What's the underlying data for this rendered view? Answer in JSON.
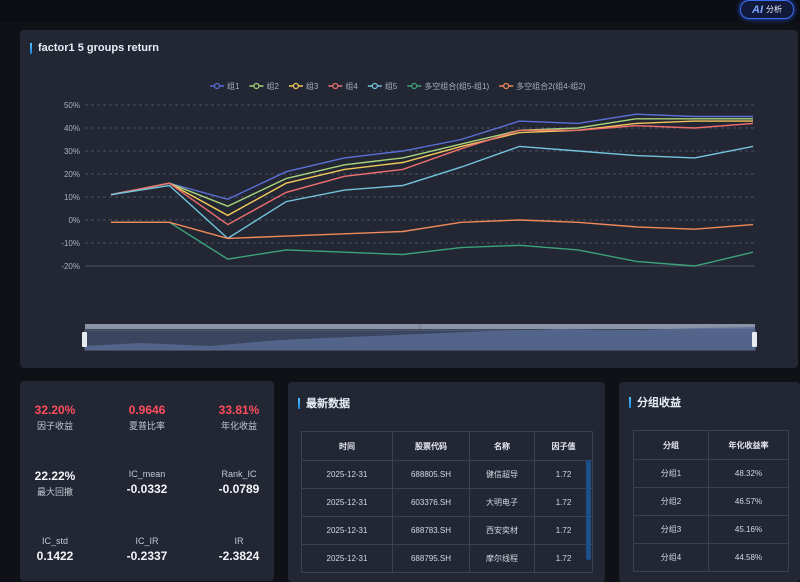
{
  "ai_button": {
    "icon_text": "AI",
    "label": "分析"
  },
  "chart": {
    "card_title": "factor1 5 groups return",
    "chart_data": {
      "type": "line",
      "ylim": [
        -20,
        50
      ],
      "yticks": [
        "50%",
        "40%",
        "30%",
        "20%",
        "10%",
        "0%",
        "-10%",
        "-20%"
      ],
      "ytick_values": [
        50,
        40,
        30,
        20,
        10,
        0,
        -10,
        -20
      ],
      "grid": true,
      "legend": "top-center",
      "x": [
        0,
        1,
        2,
        3,
        4,
        5,
        6,
        7,
        8,
        9,
        10,
        11,
        12,
        13,
        14,
        15
      ],
      "series": [
        {
          "name": "组1",
          "color": "#5b6fd8",
          "values": [
            11,
            16,
            9,
            21,
            27,
            30,
            35,
            43,
            42,
            46,
            45,
            45
          ]
        },
        {
          "name": "组2",
          "color": "#a8d37a",
          "values": [
            11,
            16,
            6,
            18,
            24,
            27,
            33,
            39,
            40,
            44,
            44,
            44
          ]
        },
        {
          "name": "组3",
          "color": "#f2c85b",
          "values": [
            11,
            16,
            2,
            16,
            22,
            25,
            32,
            38,
            39,
            42,
            43,
            43
          ]
        },
        {
          "name": "组4",
          "color": "#ef6f6f",
          "values": [
            11,
            16,
            -2,
            12,
            19,
            22,
            31,
            39,
            39,
            41,
            40,
            42
          ]
        },
        {
          "name": "组5",
          "color": "#73c4dd",
          "values": [
            11,
            15,
            -8,
            8,
            13,
            15,
            23,
            32,
            30,
            28,
            27,
            32
          ]
        },
        {
          "name": "多空组合(组5-组1)",
          "color": "#3da27a",
          "values": [
            -1,
            -1,
            -17,
            -13,
            -14,
            -15,
            -12,
            -11,
            -13,
            -18,
            -20,
            -14
          ]
        },
        {
          "name": "多空组合2(组4-组2)",
          "color": "#f08a5d",
          "values": [
            -1,
            -1,
            -8,
            -7,
            -6,
            -5,
            -1,
            0,
            -1,
            -3,
            -4,
            -2
          ]
        }
      ]
    }
  },
  "stats": {
    "factor_return": {
      "value": "32.20%",
      "label": "因子收益"
    },
    "sharpe": {
      "value": "0.9646",
      "label": "夏普比率"
    },
    "annual": {
      "value": "33.81%",
      "label": "年化收益"
    },
    "max_drawdown": {
      "value": "22.22%",
      "label": "最大回撤"
    },
    "ic_mean": {
      "value": "-0.0332",
      "label": "IC_mean"
    },
    "rank_ic": {
      "value": "-0.0789",
      "label": "Rank_IC"
    },
    "ic_std": {
      "value": "0.1422",
      "label": "IC_std"
    },
    "ic_ir": {
      "value": "-0.2337",
      "label": "IC_IR"
    },
    "ir": {
      "value": "-2.3824",
      "label": "IR"
    }
  },
  "latest": {
    "title": "最新数据",
    "headers": [
      "时间",
      "股票代码",
      "名称",
      "因子值"
    ],
    "rows": [
      [
        "2025-12-31",
        "688805.SH",
        "健信超导",
        "1.72"
      ],
      [
        "2025-12-31",
        "603376.SH",
        "大明电子",
        "1.72"
      ],
      [
        "2025-12-31",
        "688783.SH",
        "西安奕材",
        "1.72"
      ],
      [
        "2025-12-31",
        "688795.SH",
        "摩尔线程",
        "1.72"
      ]
    ]
  },
  "groups": {
    "title": "分组收益",
    "headers": [
      "分组",
      "年化收益率"
    ],
    "rows": [
      [
        "分组1",
        "48.32%"
      ],
      [
        "分组2",
        "46.57%"
      ],
      [
        "分组3",
        "45.16%"
      ],
      [
        "分组4",
        "44.58%"
      ]
    ]
  }
}
